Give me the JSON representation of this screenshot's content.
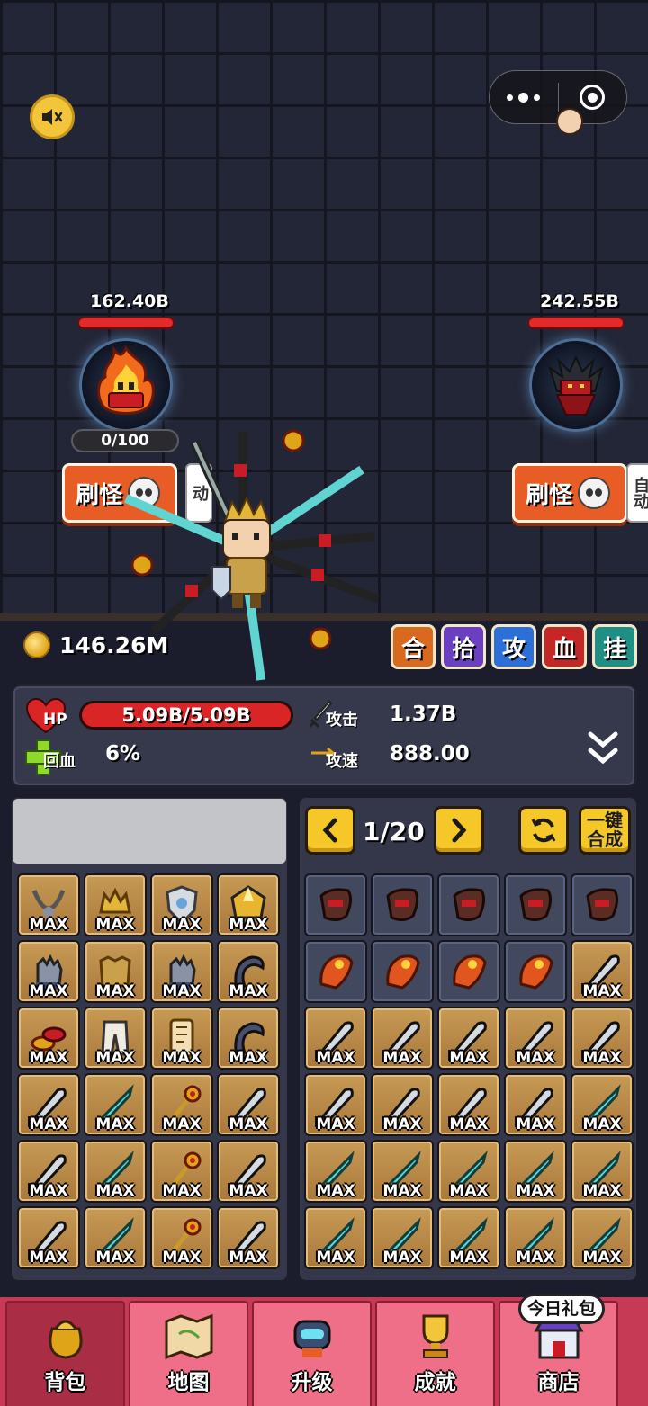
{
  "scene": {
    "enemy_left": {
      "hp_text": "162.40B",
      "hp_fraction": 1.0,
      "kill_count": "0/100",
      "spawn_label": "刷怪",
      "auto_label": "动"
    },
    "enemy_right": {
      "hp_text": "242.55B",
      "hp_fraction": 1.0,
      "spawn_label": "刷怪",
      "auto_label": "自动"
    }
  },
  "currency": {
    "gold": "146.26M"
  },
  "quick_actions": [
    {
      "label": "合",
      "color": "#d9691e"
    },
    {
      "label": "拾",
      "color": "#6a3fc2"
    },
    {
      "label": "攻",
      "color": "#2c6fd6"
    },
    {
      "label": "血",
      "color": "#c52626"
    },
    {
      "label": "挂",
      "color": "#1f8f86"
    }
  ],
  "stats": {
    "hp_label": "HP",
    "hp_value": "5.09B/5.09B",
    "hp_fraction": 1.0,
    "regen_label": "回血",
    "regen_value": "6%",
    "attack_label": "攻击",
    "attack_value": "1.37B",
    "speed_label": "攻速",
    "speed_value": "888.00"
  },
  "equipment": {
    "max_label": "MAX",
    "slots": [
      "necklace-icon",
      "helmet-icon",
      "shield-icon",
      "gem-icon",
      "gauntlet-icon",
      "armor-icon",
      "gauntlet-icon",
      "blade-ring-icon",
      "coin-stack-icon",
      "pants-icon",
      "scroll-icon",
      "blade-ring-icon",
      "machete-icon",
      "teal-sword-icon",
      "scepter-icon",
      "machete-icon",
      "machete-icon",
      "teal-sword-icon",
      "scepter-icon",
      "machete-icon",
      "machete-icon",
      "teal-sword-icon",
      "scepter-icon",
      "machete-icon"
    ]
  },
  "inventory": {
    "page": "1/20",
    "merge_all_label": "一键合成",
    "max_label": "MAX",
    "items": [
      {
        "icon": "glove-scroll-icon",
        "max": false
      },
      {
        "icon": "glove-scroll-icon",
        "max": false
      },
      {
        "icon": "glove-scroll-icon",
        "max": false
      },
      {
        "icon": "glove-scroll-icon",
        "max": false
      },
      {
        "icon": "glove-scroll-icon",
        "max": false
      },
      {
        "icon": "fire-scroll-icon",
        "max": false
      },
      {
        "icon": "fire-scroll-icon",
        "max": false
      },
      {
        "icon": "fire-scroll-icon",
        "max": false
      },
      {
        "icon": "fire-scroll-icon",
        "max": false
      },
      {
        "icon": "machete-icon",
        "max": true
      },
      {
        "icon": "machete-icon",
        "max": true
      },
      {
        "icon": "machete-icon",
        "max": true
      },
      {
        "icon": "machete-icon",
        "max": true
      },
      {
        "icon": "machete-icon",
        "max": true
      },
      {
        "icon": "machete-icon",
        "max": true
      },
      {
        "icon": "machete-icon",
        "max": true
      },
      {
        "icon": "machete-icon",
        "max": true
      },
      {
        "icon": "machete-icon",
        "max": true
      },
      {
        "icon": "machete-icon",
        "max": true
      },
      {
        "icon": "teal-sword-icon",
        "max": true
      },
      {
        "icon": "teal-sword-icon",
        "max": true
      },
      {
        "icon": "teal-sword-icon",
        "max": true
      },
      {
        "icon": "teal-sword-icon",
        "max": true
      },
      {
        "icon": "teal-sword-icon",
        "max": true
      },
      {
        "icon": "teal-sword-icon",
        "max": true
      },
      {
        "icon": "teal-sword-icon",
        "max": true
      },
      {
        "icon": "teal-sword-icon",
        "max": true
      },
      {
        "icon": "teal-sword-icon",
        "max": true
      },
      {
        "icon": "teal-sword-icon",
        "max": true
      },
      {
        "icon": "teal-sword-icon",
        "max": true
      }
    ]
  },
  "nav": {
    "gift_badge": "今日礼包",
    "items": [
      {
        "label": "背包",
        "icon": "bag-icon",
        "active": true
      },
      {
        "label": "地图",
        "icon": "map-icon",
        "active": false
      },
      {
        "label": "升级",
        "icon": "robot-icon",
        "active": false
      },
      {
        "label": "成就",
        "icon": "trophy-icon",
        "active": false
      },
      {
        "label": "商店",
        "icon": "shop-icon",
        "active": false
      }
    ]
  }
}
